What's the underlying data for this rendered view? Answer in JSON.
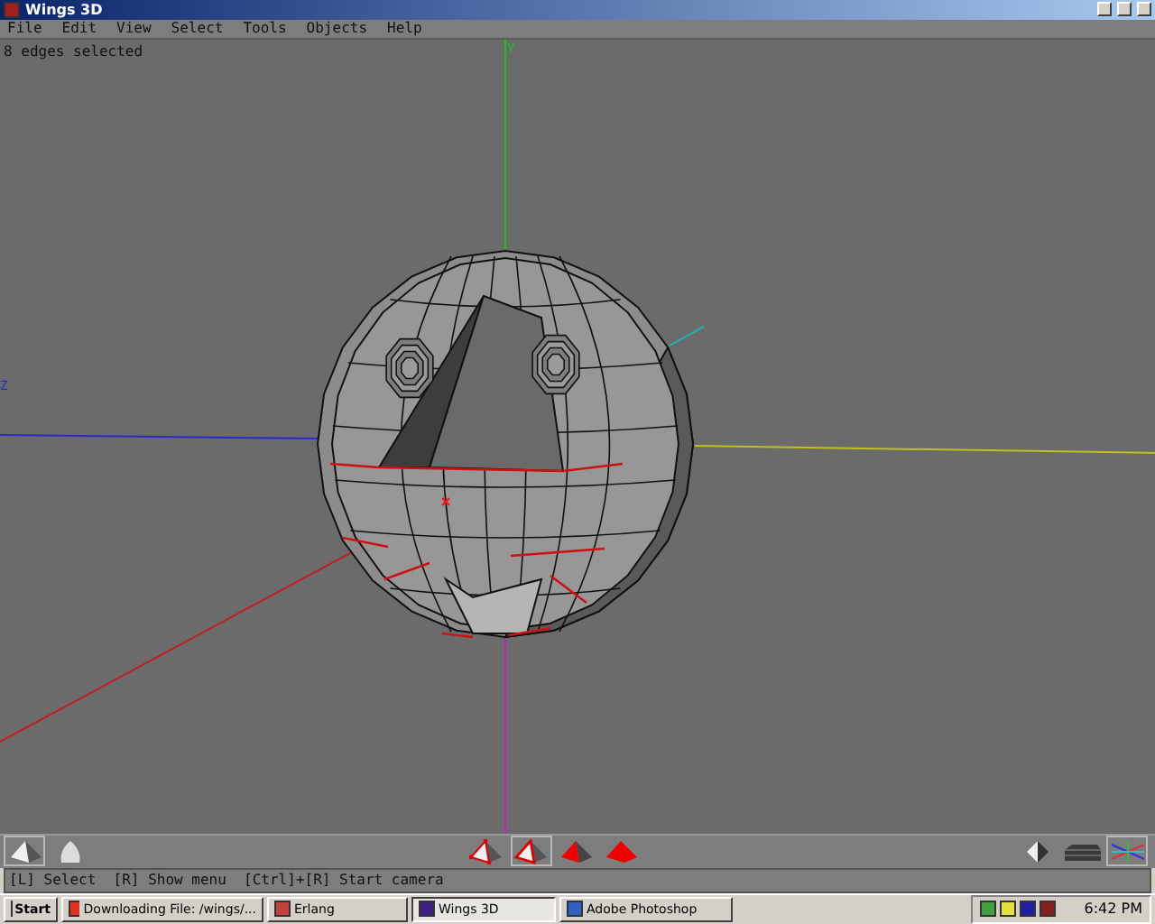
{
  "window": {
    "title": "Wings 3D"
  },
  "menu": [
    "File",
    "Edit",
    "View",
    "Select",
    "Tools",
    "Objects",
    "Help"
  ],
  "viewport": {
    "info": "8 edges selected",
    "axes": [
      {
        "kind": "y",
        "label": "Y"
      },
      {
        "kind": "z",
        "label": "Z"
      }
    ]
  },
  "toolbar": {
    "left": [
      {
        "kind": "flat",
        "selected": true
      },
      {
        "kind": "smooth",
        "selected": false
      }
    ],
    "modes": [
      {
        "kind": "vertex",
        "selected": false
      },
      {
        "kind": "edge",
        "selected": true
      },
      {
        "kind": "face",
        "selected": false
      },
      {
        "kind": "body",
        "selected": false
      }
    ],
    "right": [
      {
        "kind": "shaded",
        "selected": false
      },
      {
        "kind": "grid",
        "selected": false
      },
      {
        "kind": "axes",
        "selected": true
      }
    ]
  },
  "status_bar": "[L] Select  [R] Show menu  [Ctrl]+[R] Start camera",
  "taskbar": {
    "start": "Start",
    "tasks": [
      {
        "label": "Downloading File: /wings/...",
        "selected": false
      },
      {
        "label": "Erlang",
        "selected": false
      },
      {
        "label": "Wings 3D",
        "selected": true
      },
      {
        "label": "Adobe Photoshop",
        "selected": false
      }
    ],
    "clock": "6:42 PM"
  }
}
